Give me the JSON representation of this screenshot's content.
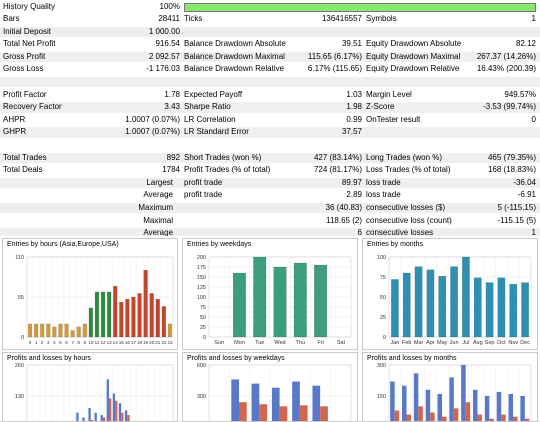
{
  "history_quality": {
    "label": "History Quality",
    "value": "100%",
    "fill_fraction": 1.0
  },
  "rows": [
    {
      "cells": [
        {
          "label": "Bars",
          "value": "28411"
        },
        {
          "label": "Ticks",
          "value": "136416557"
        },
        {
          "label": "Symbols",
          "value": "1"
        }
      ]
    },
    {
      "cells": [
        {
          "label": "Initial Deposit",
          "value": "1 000.00"
        },
        null,
        null
      ]
    },
    {
      "cells": [
        {
          "label": "Total Net Profit",
          "value": "916.54"
        },
        {
          "label": "Balance Drawdown Absolute",
          "value": "39.51"
        },
        {
          "label": "Equity Drawdown Absolute",
          "value": "82.12"
        }
      ]
    },
    {
      "cells": [
        {
          "label": "Gross Profit",
          "value": "2 092.57"
        },
        {
          "label": "Balance Drawdown Maximal",
          "value": "115.65 (6.17%)"
        },
        {
          "label": "Equity Drawdown Maximal",
          "value": "267.37 (14.26%)"
        }
      ]
    },
    {
      "cells": [
        {
          "label": "Gross Loss",
          "value": "-1 176.03"
        },
        {
          "label": "Balance Drawdown Relative",
          "value": "6.17% (115.65)"
        },
        {
          "label": "Equity Drawdown Relative",
          "value": "16.43% (200.39)"
        }
      ]
    },
    {
      "cells": [
        null,
        null,
        null
      ]
    },
    {
      "cells": [
        {
          "label": "Profit Factor",
          "value": "1.78"
        },
        {
          "label": "Expected Payoff",
          "value": "1.03"
        },
        {
          "label": "Margin Level",
          "value": "949.57%"
        }
      ]
    },
    {
      "cells": [
        {
          "label": "Recovery Factor",
          "value": "3.43"
        },
        {
          "label": "Sharpe Ratio",
          "value": "1.98"
        },
        {
          "label": "Z-Score",
          "value": "-3.53 (99.74%)"
        }
      ]
    },
    {
      "cells": [
        {
          "label": "AHPR",
          "value": "1.0007 (0.07%)"
        },
        {
          "label": "LR Correlation",
          "value": "0.99"
        },
        {
          "label": "OnTester result",
          "value": "0"
        }
      ]
    },
    {
      "cells": [
        {
          "label": "GHPR",
          "value": "1.0007 (0.07%)"
        },
        {
          "label": "LR Standard Error",
          "value": "37.57"
        },
        null
      ]
    },
    {
      "cells": [
        null,
        null,
        null
      ]
    },
    {
      "cells": [
        {
          "label": "Total Trades",
          "value": "892"
        },
        {
          "label": "Short Trades (won %)",
          "value": "427 (83.14%)"
        },
        {
          "label": "Long Trades (won %)",
          "value": "465 (79.35%)"
        }
      ]
    },
    {
      "cells": [
        {
          "label": "Total Deals",
          "value": "1784"
        },
        {
          "label": "Profit Trades (% of total)",
          "value": "724 (81.17%)"
        },
        {
          "label": "Loss Trades (% of total)",
          "value": "168 (18.83%)"
        }
      ]
    },
    {
      "cells": [
        {
          "label": "Largest",
          "value": "",
          "right": true
        },
        {
          "label": "profit trade",
          "value": "89.97"
        },
        {
          "label": "loss trade",
          "value": "-36.04"
        }
      ]
    },
    {
      "cells": [
        {
          "label": "Average",
          "value": "",
          "right": true
        },
        {
          "label": "profit trade",
          "value": "2.89"
        },
        {
          "label": "loss trade",
          "value": "-6.91"
        }
      ]
    },
    {
      "cells": [
        {
          "label": "Maximum",
          "value": "",
          "right": true
        },
        {
          "label": "",
          "value": "36 (40.83)"
        },
        {
          "label": "consecutive losses ($)",
          "value": "5 (-115.15)"
        }
      ]
    },
    {
      "cells": [
        {
          "label": "Maximal",
          "value": "",
          "right": true
        },
        {
          "label": "",
          "value": "118.65 (2)"
        },
        {
          "label": "consecutive loss (count)",
          "value": "-115.15 (5)"
        }
      ]
    },
    {
      "cells": [
        {
          "label": "Average",
          "value": "",
          "right": true
        },
        {
          "label": "",
          "value": "6"
        },
        {
          "label": "consecutive losses",
          "value": "1"
        }
      ]
    }
  ],
  "chart_data": [
    {
      "type": "bar",
      "title": "Entries by hours (Asia,Europe,USA)",
      "categories": [
        "0",
        "1",
        "2",
        "3",
        "4",
        "5",
        "6",
        "7",
        "8",
        "9",
        "10",
        "11",
        "12",
        "13",
        "14",
        "15",
        "16",
        "17",
        "18",
        "19",
        "20",
        "21",
        "22",
        "23"
      ],
      "values": [
        18,
        18,
        18,
        18,
        14,
        18,
        18,
        9,
        14,
        18,
        40,
        62,
        62,
        62,
        70,
        48,
        52,
        55,
        60,
        92,
        60,
        52,
        42,
        18
      ],
      "ylim": [
        0,
        110
      ],
      "yticks": [
        "110",
        "55",
        "0"
      ],
      "colors": [
        "#d19a3d",
        "#d19a3d",
        "#d19a3d",
        "#d19a3d",
        "#d19a3d",
        "#d19a3d",
        "#d19a3d",
        "#d19a3d",
        "#d19a3d",
        "#d19a3d",
        "#2e8b3e",
        "#2e8b3e",
        "#2e8b3e",
        "#2e8b3e",
        "#c0472f",
        "#c0472f",
        "#c0472f",
        "#c0472f",
        "#c0472f",
        "#c0472f",
        "#c0472f",
        "#c0472f",
        "#c0472f",
        "#d19a3d"
      ]
    },
    {
      "type": "bar",
      "title": "Entries by weekdays",
      "categories": [
        "Sun",
        "Mon",
        "Tue",
        "Wed",
        "Thu",
        "Fri",
        "Sat"
      ],
      "values": [
        0,
        160,
        200,
        175,
        185,
        180,
        0
      ],
      "ylim": [
        0,
        200
      ],
      "yticks": [
        "200",
        "175",
        "150",
        "125",
        "100",
        "75",
        "50",
        "25",
        "0"
      ],
      "color": "#3c9e7a"
    },
    {
      "type": "bar",
      "title": "Entries by months",
      "categories": [
        "Jan",
        "Feb",
        "Mar",
        "Apr",
        "May",
        "Jun",
        "Jul",
        "Aug",
        "Sep",
        "Oct",
        "Nov",
        "Dec"
      ],
      "values": [
        72,
        80,
        88,
        84,
        76,
        88,
        100,
        74,
        68,
        74,
        66,
        68
      ],
      "ylim": [
        0,
        100
      ],
      "yticks": [
        "100",
        "75",
        "50",
        "25",
        "0"
      ],
      "color": "#2f8fb0"
    },
    {
      "type": "bar",
      "title": "Profits and losses by hours",
      "categories": [
        "0",
        "1",
        "2",
        "3",
        "4",
        "5",
        "6",
        "7",
        "8",
        "9",
        "10",
        "11",
        "12",
        "13",
        "14",
        "15",
        "16",
        "17",
        "18",
        "19",
        "20",
        "21",
        "22",
        "23"
      ],
      "series": [
        {
          "values": [
            0,
            0,
            0,
            0,
            0,
            0,
            0,
            0,
            60,
            40,
            80,
            60,
            50,
            200,
            140,
            100,
            70,
            0,
            0,
            0,
            0,
            0,
            0,
            0
          ]
        },
        {
          "values": [
            0,
            0,
            0,
            0,
            0,
            0,
            0,
            0,
            20,
            10,
            30,
            20,
            40,
            120,
            110,
            60,
            50,
            0,
            0,
            0,
            0,
            0,
            0,
            0
          ]
        }
      ],
      "ylim": [
        0,
        260
      ],
      "yticks": [
        "260",
        "130"
      ]
    },
    {
      "type": "bar",
      "title": "Profits and losses by weekdays",
      "categories": [
        "Sun",
        "Mon",
        "Tue",
        "Wed",
        "Thu",
        "Fri",
        "Sat"
      ],
      "series": [
        {
          "values": [
            0,
            460,
            420,
            380,
            440,
            400,
            0
          ]
        },
        {
          "values": [
            0,
            240,
            220,
            200,
            210,
            200,
            0
          ]
        }
      ],
      "ylim": [
        0,
        600
      ],
      "yticks": [
        "600",
        "300"
      ]
    },
    {
      "type": "bar",
      "title": "Profits and losses by months",
      "categories": [
        "Jan",
        "Feb",
        "Mar",
        "Apr",
        "May",
        "Jun",
        "Jul",
        "Aug",
        "Sep",
        "Oct",
        "Nov",
        "Dec"
      ],
      "series": [
        {
          "values": [
            220,
            200,
            260,
            180,
            160,
            240,
            300,
            180,
            150,
            170,
            160,
            150
          ]
        },
        {
          "values": [
            80,
            60,
            100,
            70,
            50,
            90,
            120,
            60,
            40,
            60,
            50,
            40
          ]
        }
      ],
      "ylim": [
        0,
        300
      ],
      "yticks": [
        "300",
        "150"
      ]
    }
  ]
}
